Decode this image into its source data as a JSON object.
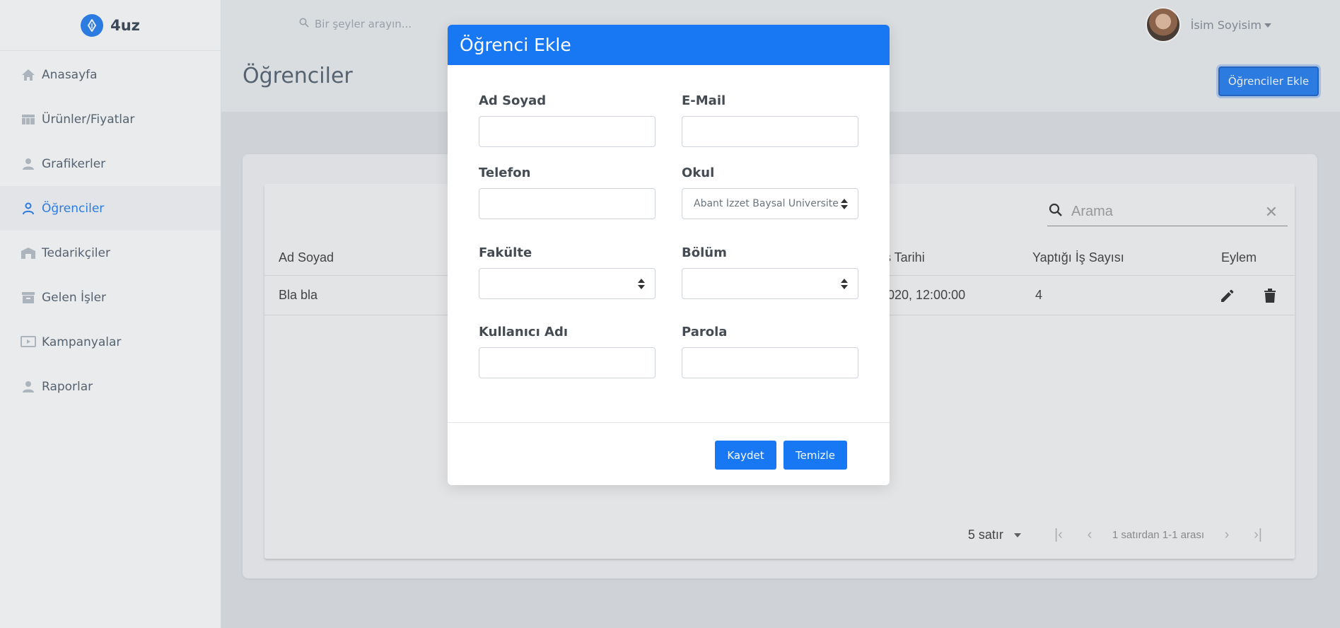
{
  "brand": {
    "name": "4uz"
  },
  "sidebar": {
    "items": [
      {
        "label": "Anasayfa",
        "icon": "home-icon"
      },
      {
        "label": "Ürünler/Fiyatlar",
        "icon": "table-icon"
      },
      {
        "label": "Grafikerler",
        "icon": "person-icon"
      },
      {
        "label": "Öğrenciler",
        "icon": "person-outline-icon",
        "active": true
      },
      {
        "label": "Tedarikçiler",
        "icon": "store-icon"
      },
      {
        "label": "Gelen İşler",
        "icon": "archive-icon"
      },
      {
        "label": "Kampanyalar",
        "icon": "tv-play-icon"
      },
      {
        "label": "Raporlar",
        "icon": "person-icon"
      }
    ]
  },
  "topbar": {
    "search_placeholder": "Bir şeyler arayın...",
    "user_name": "İsim Soyisim"
  },
  "page": {
    "title": "Öğrenciler",
    "add_button": "Öğrenciler Ekle"
  },
  "table": {
    "search_placeholder": "Arama",
    "headers": {
      "name": "Ad Soyad",
      "date": "ş Tarihi",
      "jobs": "Yaptığı İş Sayısı",
      "action": "Eylem"
    },
    "rows": [
      {
        "name": "Bla bla",
        "date": "020, 12:00:00",
        "jobs": "4"
      }
    ],
    "pagination": {
      "rows_per_page": "5 satır",
      "info": "1 satırdan 1-1 arası"
    }
  },
  "modal": {
    "title": "Öğrenci Ekle",
    "fields": {
      "ad_soyad": {
        "label": "Ad Soyad",
        "value": ""
      },
      "email": {
        "label": "E-Mail",
        "value": ""
      },
      "telefon": {
        "label": "Telefon",
        "value": ""
      },
      "okul": {
        "label": "Okul",
        "value": "Abant İzzet Baysal Üniversitesi"
      },
      "fakulte": {
        "label": "Fakülte",
        "value": ""
      },
      "bolum": {
        "label": "Bölüm",
        "value": ""
      },
      "kullanici_adi": {
        "label": "Kullanıcı Adı",
        "value": ""
      },
      "parola": {
        "label": "Parola",
        "value": ""
      }
    },
    "save_button": "Kaydet",
    "clear_button": "Temizle"
  },
  "colors": {
    "primary": "#1877f2",
    "sidebar_bg": "#ffffff",
    "page_bg": "#eceef1"
  }
}
